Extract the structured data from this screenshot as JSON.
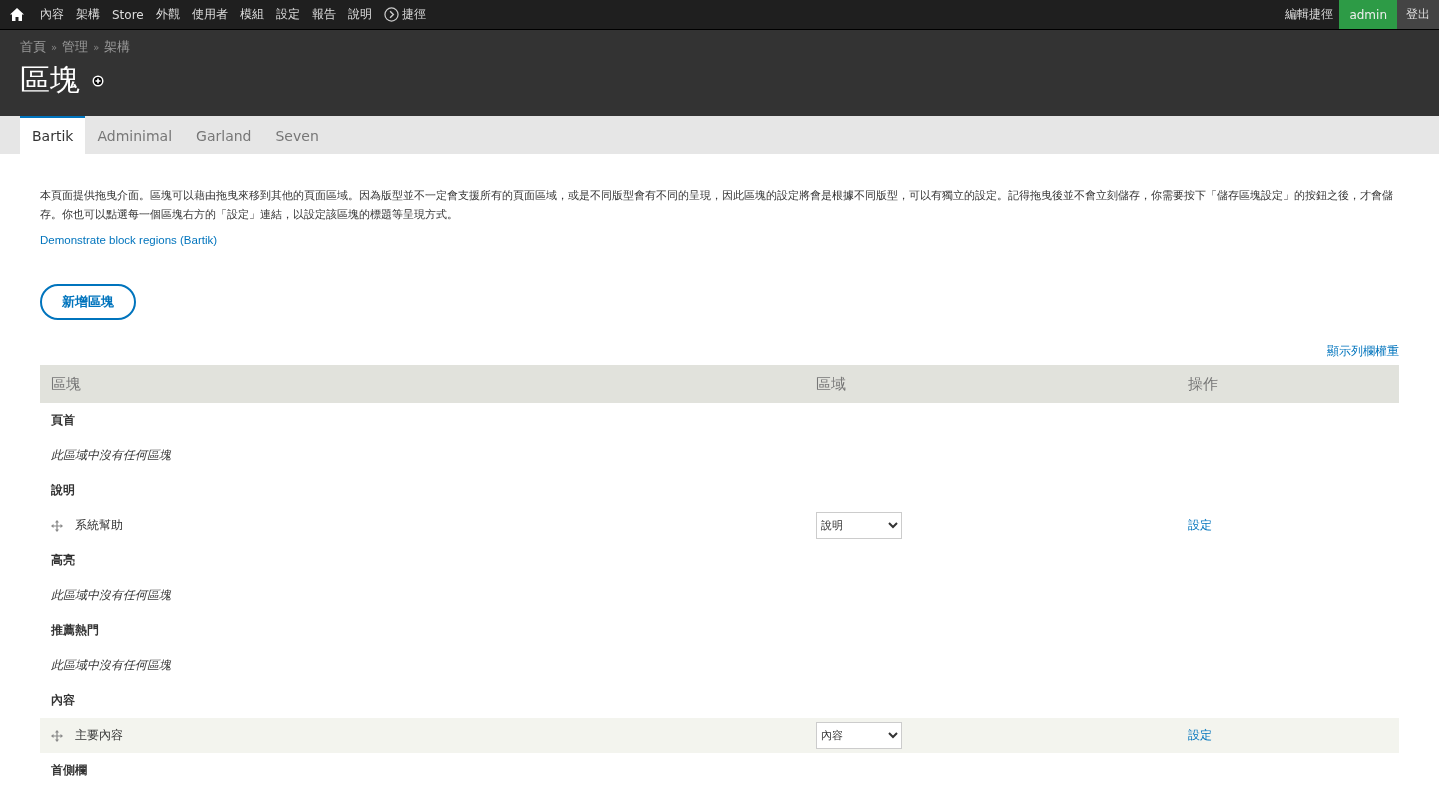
{
  "toolbar": {
    "items": [
      "內容",
      "架構",
      "Store",
      "外觀",
      "使用者",
      "模組",
      "設定",
      "報告",
      "說明"
    ],
    "shortcuts": "捷徑",
    "edit_shortcuts": "編輯捷徑",
    "user": "admin",
    "logout": "登出"
  },
  "breadcrumb": [
    "首頁",
    "»",
    "管理",
    "»",
    "架構"
  ],
  "page_title": "區塊",
  "tabs": [
    {
      "label": "Bartik",
      "selected": true
    },
    {
      "label": "Adminimal",
      "selected": false
    },
    {
      "label": "Garland",
      "selected": false
    },
    {
      "label": "Seven",
      "selected": false
    }
  ],
  "description": "本頁面提供拖曳介面。區塊可以藉由拖曳來移到其他的頁面區域。因為版型並不一定會支援所有的頁面區域，或是不同版型會有不同的呈現，因此區塊的設定將會是根據不同版型，可以有獨立的設定。記得拖曳後並不會立刻儲存，你需要按下「儲存區塊設定」的按鈕之後，才會儲存。你也可以點選每一個區塊右方的「設定」連結，以設定該區塊的標題等呈現方式。",
  "demo_link": "Demonstrate block regions (Bartik)",
  "add_button": "新增區塊",
  "show_weights": "顯示列欄權重",
  "table": {
    "columns": [
      "區塊",
      "區域",
      "操作"
    ],
    "rows": [
      {
        "kind": "region",
        "text": "頁首"
      },
      {
        "kind": "empty",
        "text": "此區域中沒有任何區塊"
      },
      {
        "kind": "region",
        "text": "說明"
      },
      {
        "kind": "block",
        "text": "系統幫助",
        "region": "說明",
        "action": "設定",
        "highlighted": false
      },
      {
        "kind": "region",
        "text": "高亮"
      },
      {
        "kind": "empty",
        "text": "此區域中沒有任何區塊"
      },
      {
        "kind": "region",
        "text": "推薦熱門"
      },
      {
        "kind": "empty",
        "text": "此區域中沒有任何區塊"
      },
      {
        "kind": "region",
        "text": "內容"
      },
      {
        "kind": "block",
        "text": "主要內容",
        "region": "內容",
        "action": "設定",
        "highlighted": true
      },
      {
        "kind": "region",
        "text": "首側欄"
      }
    ]
  }
}
